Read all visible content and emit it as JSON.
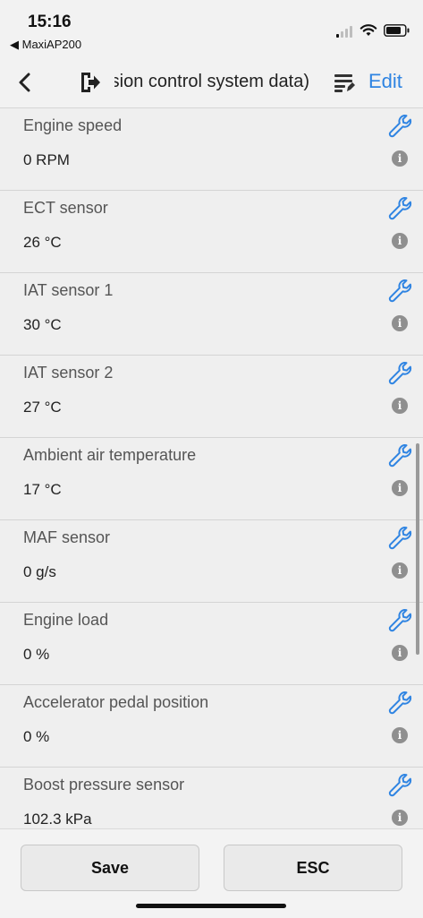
{
  "status_bar": {
    "time": "15:16",
    "back_app_label": "◀ MaxiAP200"
  },
  "nav": {
    "title": "(Propulsion control system data)",
    "edit_label": "Edit",
    "accent_color": "#2f84e2"
  },
  "rows": [
    {
      "label": "Engine speed",
      "value": "0 RPM"
    },
    {
      "label": "ECT sensor",
      "value": "26 °C"
    },
    {
      "label": "IAT sensor 1",
      "value": "30 °C"
    },
    {
      "label": "IAT sensor 2",
      "value": "27 °C"
    },
    {
      "label": "Ambient air temperature",
      "value": "17 °C"
    },
    {
      "label": "MAF sensor",
      "value": "0 g/s"
    },
    {
      "label": "Engine load",
      "value": "0 %"
    },
    {
      "label": "Accelerator pedal position",
      "value": "0 %"
    },
    {
      "label": "Boost pressure sensor",
      "value": "102.3 kPa"
    }
  ],
  "footer": {
    "save_label": "Save",
    "esc_label": "ESC"
  }
}
